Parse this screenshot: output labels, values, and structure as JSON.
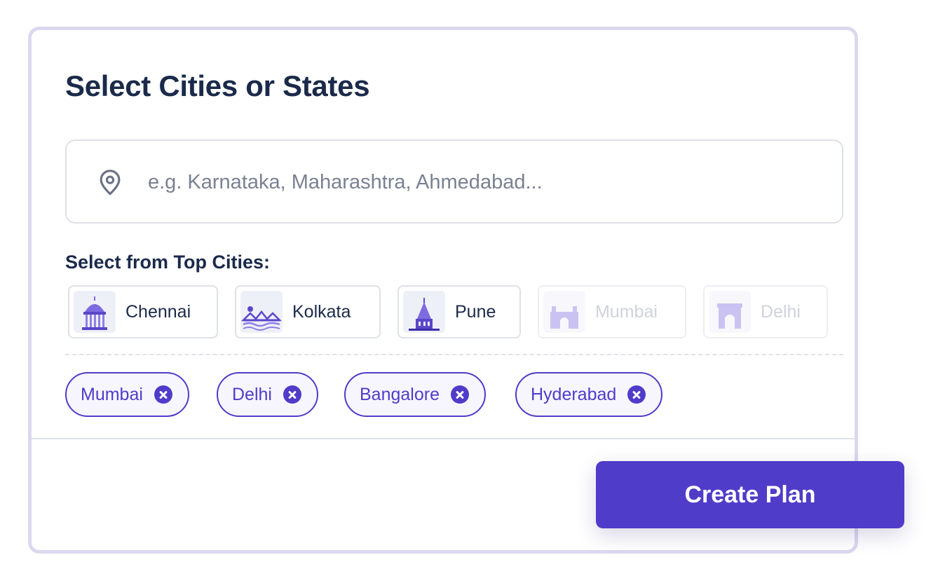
{
  "card": {
    "title": "Select Cities or States"
  },
  "search": {
    "value": "",
    "placeholder": "e.g. Karnataka, Maharashtra, Ahmedabad..."
  },
  "top_cities": {
    "label": "Select from Top Cities:",
    "items": [
      {
        "name": "Chennai",
        "enabled": true,
        "icon": "chennai-landmark-icon"
      },
      {
        "name": "Kolkata",
        "enabled": true,
        "icon": "kolkata-bridge-icon"
      },
      {
        "name": "Pune",
        "enabled": true,
        "icon": "pune-temple-icon"
      },
      {
        "name": "Mumbai",
        "enabled": false,
        "icon": "mumbai-gateway-icon"
      },
      {
        "name": "Delhi",
        "enabled": false,
        "icon": "delhi-india-gate-icon"
      }
    ]
  },
  "selected": {
    "chips": [
      {
        "label": "Mumbai"
      },
      {
        "label": "Delhi"
      },
      {
        "label": "Bangalore"
      },
      {
        "label": "Hyderabad"
      }
    ]
  },
  "actions": {
    "create_plan_label": "Create Plan"
  },
  "colors": {
    "accent": "#4f3cc9",
    "heading": "#1b2a4a",
    "border": "#dfe1e8",
    "card_border": "#dcd8ef",
    "placeholder": "#7a8192"
  }
}
